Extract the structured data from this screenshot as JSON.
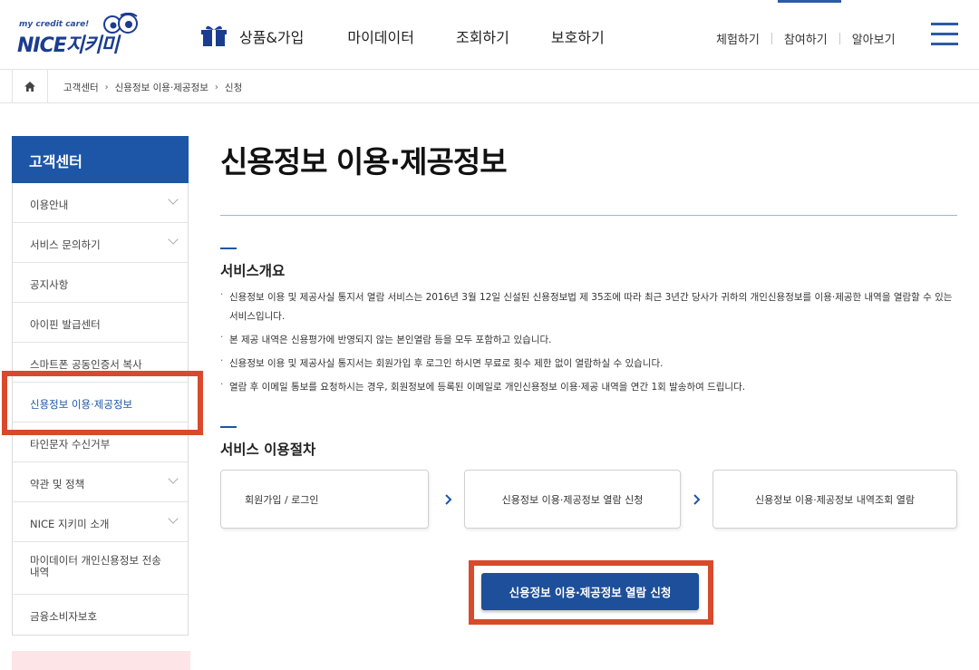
{
  "header": {
    "logo": {
      "tagline": "my credit care!",
      "brand": "NICE지키미"
    },
    "nav": [
      "상품&가입",
      "마이데이터",
      "조회하기",
      "보호하기"
    ],
    "util": [
      "체험하기",
      "참여하기",
      "알아보기"
    ],
    "accent_color": "#2b5aa8"
  },
  "breadcrumb": [
    "고객센터",
    "신용정보 이용·제공정보",
    "신청"
  ],
  "sidebar": {
    "title": "고객센터",
    "header_color": "#1d56a6",
    "items": [
      {
        "label": "이용안내"
      },
      {
        "label": "서비스 문의하기"
      },
      {
        "label": "공지사항"
      },
      {
        "label": "아이핀 발급센터"
      },
      {
        "label": "스마트폰 공동인증서 복사"
      },
      {
        "label": "신용정보 이용·제공정보"
      },
      {
        "label": "타인문자 수신거부"
      },
      {
        "label": "약관 및 정책"
      },
      {
        "label": "NICE 지키미 소개"
      },
      {
        "label": "마이데이터 개인신용정보 전송 내역"
      },
      {
        "label": "금융소비자보호"
      }
    ]
  },
  "main": {
    "title": "신용정보 이용·제공정보",
    "overview": {
      "heading": "서비스개요",
      "bullets": [
        "신용정보 이용 및 제공사실 통지서 열람 서비스는 2016년 3월 12일 신설된 신용정보법 제 35조에 따라 최근 3년간 당사가 귀하의 개인신용정보를 이용·제공한 내역을 열람할 수 있는 서비스입니다.",
        "본 제공 내역은 신용평가에 반영되지 않는 본인열람 등을 모두 포함하고 있습니다.",
        "신용정보 이용 및 제공사실 통지서는 회원가입 후 로그인 하시면 무료로 횟수 제한 없이 열람하실 수 있습니다.",
        "열람 후 이메일 통보를 요청하시는 경우, 회원정보에 등록된 이메일로 개인신용정보 이용·제공 내역을 연간 1회 발송하여 드립니다."
      ]
    },
    "procedure": {
      "heading": "서비스 이용절차",
      "steps": [
        "회원가입 / 로그인",
        "신용정보 이용·제공정보 열람 신청",
        "신용정보 이용·제공정보 내역조회 열람"
      ]
    },
    "apply_button": "신용정보 이용·제공정보 열람 신청",
    "highlight_color": "#d84a2c"
  }
}
